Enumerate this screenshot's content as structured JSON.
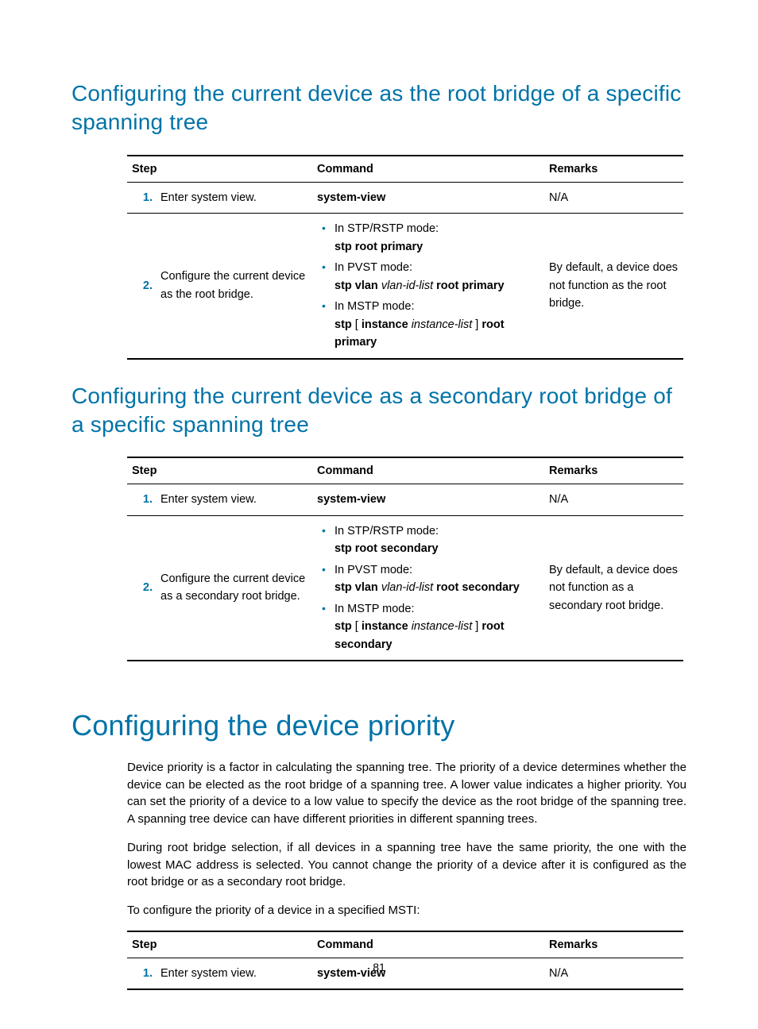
{
  "page_number": "81",
  "sections": [
    {
      "heading": "Configuring the current device as the root bridge of a specific spanning tree",
      "heading_level": "h2",
      "table": {
        "headers": {
          "step": "Step",
          "command": "Command",
          "remarks": "Remarks"
        },
        "rows": [
          {
            "num": "1.",
            "step": "Enter system view.",
            "command_plain": "system-view",
            "remarks": "N/A",
            "bullets": null
          },
          {
            "num": "2.",
            "step": "Configure the current device as the root bridge.",
            "bullets": [
              {
                "label": "In STP/RSTP mode:",
                "parts": [
                  {
                    "t": "stp root primary",
                    "b": true
                  }
                ]
              },
              {
                "label": "In PVST mode:",
                "parts": [
                  {
                    "t": "stp vlan ",
                    "b": true
                  },
                  {
                    "t": "vlan-id-list ",
                    "i": true
                  },
                  {
                    "t": "root primary",
                    "b": true
                  }
                ]
              },
              {
                "label": "In MSTP mode:",
                "parts": [
                  {
                    "t": "stp ",
                    "b": true
                  },
                  {
                    "t": "[ "
                  },
                  {
                    "t": "instance ",
                    "b": true
                  },
                  {
                    "t": "instance-list ",
                    "i": true
                  },
                  {
                    "t": "] "
                  },
                  {
                    "t": "root primary",
                    "b": true
                  }
                ]
              }
            ],
            "remarks": "By default, a device does not function as the root bridge."
          }
        ]
      }
    },
    {
      "heading": "Configuring the current device as a secondary root bridge of a specific spanning tree",
      "heading_level": "h2",
      "table": {
        "headers": {
          "step": "Step",
          "command": "Command",
          "remarks": "Remarks"
        },
        "rows": [
          {
            "num": "1.",
            "step": "Enter system view.",
            "command_plain": "system-view",
            "remarks": "N/A",
            "bullets": null
          },
          {
            "num": "2.",
            "step": "Configure the current device as a secondary root bridge.",
            "bullets": [
              {
                "label": "In STP/RSTP mode:",
                "parts": [
                  {
                    "t": "stp root secondary",
                    "b": true
                  }
                ]
              },
              {
                "label": "In PVST mode:",
                "parts": [
                  {
                    "t": "stp vlan ",
                    "b": true
                  },
                  {
                    "t": "vlan-id-list ",
                    "i": true
                  },
                  {
                    "t": "root secondary",
                    "b": true
                  }
                ]
              },
              {
                "label": "In MSTP mode:",
                "parts": [
                  {
                    "t": "stp ",
                    "b": true
                  },
                  {
                    "t": "[ "
                  },
                  {
                    "t": "instance ",
                    "b": true
                  },
                  {
                    "t": "instance-list ",
                    "i": true
                  },
                  {
                    "t": "] "
                  },
                  {
                    "t": "root secondary",
                    "b": true
                  }
                ]
              }
            ],
            "remarks": "By default, a device does not function as a secondary root bridge."
          }
        ]
      }
    },
    {
      "heading": "Configuring the device priority",
      "heading_level": "h1",
      "paragraphs": [
        "Device priority is a factor in calculating the spanning tree. The priority of a device determines whether the device can be elected as the root bridge of a spanning tree. A lower value indicates a higher priority. You can set the priority of a device to a low value to specify the device as the root bridge of the spanning tree. A spanning tree device can have different priorities in different spanning trees.",
        "During root bridge selection, if all devices in a spanning tree have the same priority, the one with the lowest MAC address is selected. You cannot change the priority of a device after it is configured as the root bridge or as a secondary root bridge.",
        "To configure the priority of a device in a specified MSTI:"
      ],
      "para_align": [
        "justify",
        "justify",
        "left"
      ],
      "table": {
        "headers": {
          "step": "Step",
          "command": "Command",
          "remarks": "Remarks"
        },
        "rows": [
          {
            "num": "1.",
            "step": "Enter system view.",
            "command_plain": "system-view",
            "remarks": "N/A",
            "bullets": null
          }
        ]
      }
    }
  ]
}
